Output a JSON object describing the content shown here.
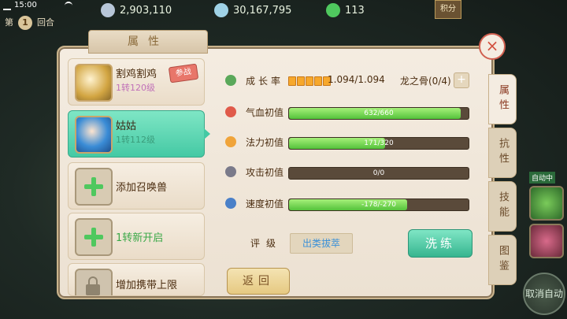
{
  "status": {
    "time": "15:00"
  },
  "currencies": [
    {
      "value": "2,903,110",
      "color": "#b7c6d8",
      "icon": "silver-coin-icon"
    },
    {
      "value": "30,167,795",
      "color": "#9fd2e6",
      "icon": "ingot-icon"
    },
    {
      "value": "113",
      "color": "#4fc85e",
      "icon": "jade-icon"
    }
  ],
  "round": {
    "prefix": "第",
    "number": "1",
    "suffix": "回合"
  },
  "chest_label": "积分",
  "panel": {
    "title": "属性"
  },
  "pets": [
    {
      "name": "割鸡割鸡",
      "level": "1转120级",
      "badge": "参战",
      "avatar": "golden-dragon-avatar"
    },
    {
      "name": "姑姑",
      "level": "1转112级",
      "avatar": "blue-girl-avatar",
      "selected": true
    }
  ],
  "actions": [
    {
      "label": "添加召唤兽"
    },
    {
      "label": "1转新开启"
    },
    {
      "label": "增加携带上限"
    }
  ],
  "stats": {
    "growth": {
      "label": "成长率",
      "value": "1.094/1.094",
      "bone": "龙之骨(0/4)"
    },
    "hp": {
      "label": "气血初值",
      "value": "632/660",
      "fill": 0.958
    },
    "mp": {
      "label": "法力初值",
      "value": "171/320",
      "fill": 0.534
    },
    "atk": {
      "label": "攻击初值",
      "value": "0/0",
      "fill": 0.0
    },
    "spd": {
      "label": "速度初值",
      "value": "-178/-270",
      "fill": 0.659
    }
  },
  "grade": {
    "label": "评级",
    "value": "出类拔萃"
  },
  "buttons": {
    "refine": "洗练",
    "back": "返回"
  },
  "tabs": [
    {
      "label": "属性",
      "active": true
    },
    {
      "label": "抗性",
      "active": false
    },
    {
      "label": "技能",
      "active": false
    },
    {
      "label": "图鉴",
      "active": false
    }
  ],
  "hud": {
    "auto_label": "自动中",
    "cancel_auto": "取消自动"
  }
}
